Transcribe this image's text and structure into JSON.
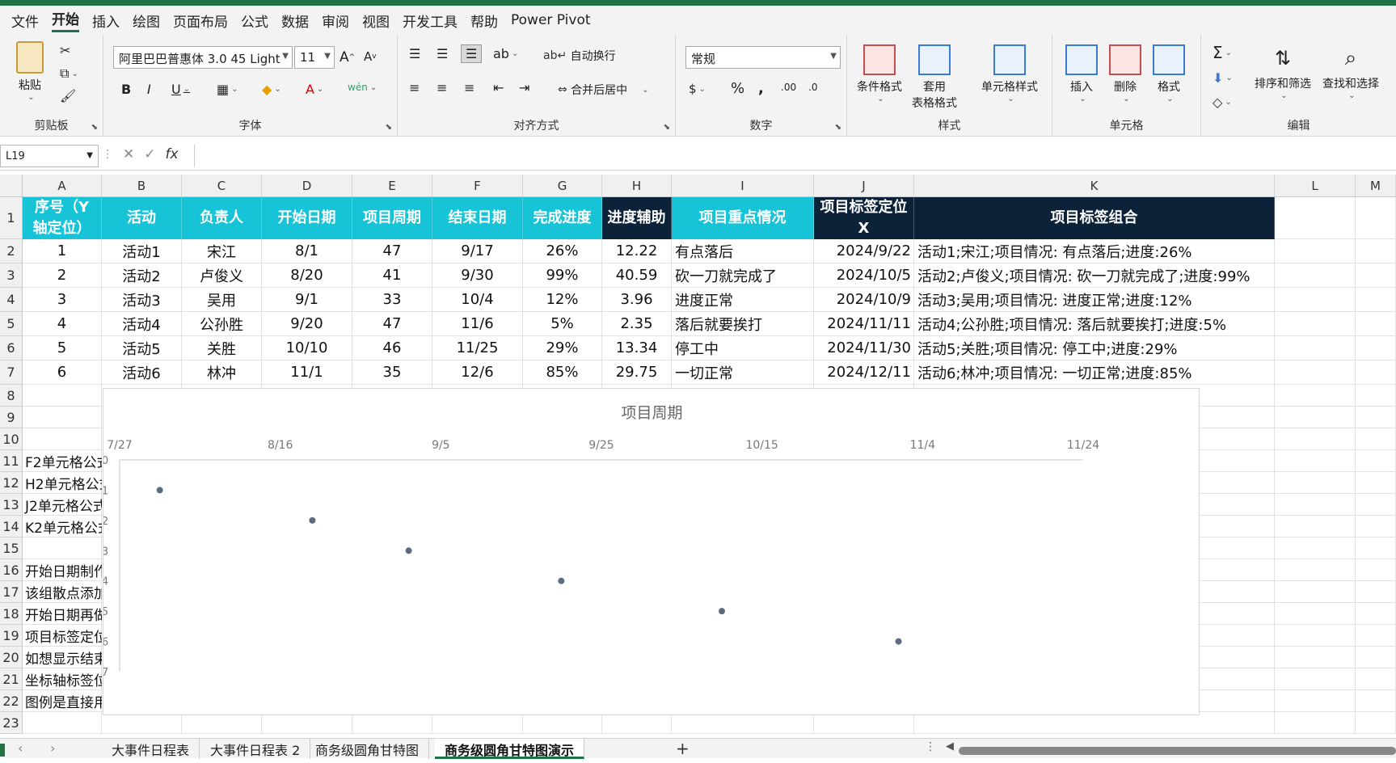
{
  "menu": [
    "文件",
    "开始",
    "插入",
    "绘图",
    "页面布局",
    "公式",
    "数据",
    "审阅",
    "视图",
    "开发工具",
    "帮助",
    "Power Pivot"
  ],
  "ribbon": {
    "clipboard": {
      "paste": "粘贴",
      "label": "剪贴板"
    },
    "font": {
      "name": "阿里巴巴普惠体 3.0 45 Light",
      "size": "11",
      "label": "字体"
    },
    "alignment": {
      "wrap": "自动换行",
      "merge": "合并后居中",
      "label": "对齐方式"
    },
    "number": {
      "format": "常规",
      "label": "数字"
    },
    "styles": {
      "conditional": "条件格式",
      "table_line1": "套用",
      "table_line2": "表格格式",
      "cell_styles": "单元格样式",
      "label": "样式"
    },
    "cells": {
      "insert": "插入",
      "delete": "删除",
      "format": "格式",
      "label": "单元格"
    },
    "editing": {
      "sort": "排序和筛选",
      "find": "查找和选择",
      "label": "编辑"
    }
  },
  "namebox": "L19",
  "columns": [
    "A",
    "B",
    "C",
    "D",
    "E",
    "F",
    "G",
    "H",
    "I",
    "J",
    "K",
    "L",
    "M"
  ],
  "rows": [
    "1",
    "2",
    "3",
    "4",
    "5",
    "6",
    "7",
    "8",
    "9",
    "10",
    "11",
    "12",
    "13",
    "14",
    "15",
    "16",
    "17",
    "18",
    "19",
    "20",
    "21",
    "22",
    "23"
  ],
  "headers": {
    "A": "序号（Y轴定位）",
    "B": "活动",
    "C": "负责人",
    "D": "开始日期",
    "E": "项目周期",
    "F": "结束日期",
    "G": "完成进度",
    "H": "进度辅助",
    "I": "项目重点情况",
    "J": "项目标签定位X",
    "K": "项目标签组合"
  },
  "table": [
    {
      "a": "1",
      "b": "活动1",
      "c": "宋江",
      "d": "8/1",
      "e": "47",
      "f": "9/17",
      "g": "26%",
      "h": "12.22",
      "i": "有点落后",
      "j": "2024/9/22",
      "k": "活动1;宋江;项目情况: 有点落后;进度:26%"
    },
    {
      "a": "2",
      "b": "活动2",
      "c": "卢俊义",
      "d": "8/20",
      "e": "41",
      "f": "9/30",
      "g": "99%",
      "h": "40.59",
      "i": "砍一刀就完成了",
      "j": "2024/10/5",
      "k": "活动2;卢俊义;项目情况: 砍一刀就完成了;进度:99%"
    },
    {
      "a": "3",
      "b": "活动3",
      "c": "吴用",
      "d": "9/1",
      "e": "33",
      "f": "10/4",
      "g": "12%",
      "h": "3.96",
      "i": "进度正常",
      "j": "2024/10/9",
      "k": "活动3;吴用;项目情况: 进度正常;进度:12%"
    },
    {
      "a": "4",
      "b": "活动4",
      "c": "公孙胜",
      "d": "9/20",
      "e": "47",
      "f": "11/6",
      "g": "5%",
      "h": "2.35",
      "i": "落后就要挨打",
      "j": "2024/11/11",
      "k": "活动4;公孙胜;项目情况: 落后就要挨打;进度:5%"
    },
    {
      "a": "5",
      "b": "活动5",
      "c": "关胜",
      "d": "10/10",
      "e": "46",
      "f": "11/25",
      "g": "29%",
      "h": "13.34",
      "i": "停工中",
      "j": "2024/11/30",
      "k": "活动5;关胜;项目情况: 停工中;进度:29%"
    },
    {
      "a": "6",
      "b": "活动6",
      "c": "林冲",
      "d": "11/1",
      "e": "35",
      "f": "12/6",
      "g": "85%",
      "h": "29.75",
      "i": "一切正常",
      "j": "2024/12/11",
      "k": "活动6;林冲;项目情况: 一切正常;进度:85%"
    }
  ],
  "notes": [
    {
      "row": "11",
      "text": "F2单元格公式"
    },
    {
      "row": "12",
      "text": "H2单元格公式"
    },
    {
      "row": "13",
      "text": "J2单元格公式"
    },
    {
      "row": "14",
      "text": "K2单元格公式"
    },
    {
      "row": "16",
      "text": "开始日期制作"
    },
    {
      "row": "17",
      "text": "该组散点添加"
    },
    {
      "row": "18",
      "text": "开始日期再做"
    },
    {
      "row": "19",
      "text": "项目标签定位"
    },
    {
      "row": "20",
      "text": "如想显示结束"
    },
    {
      "row": "21",
      "text": "坐标轴标签位"
    },
    {
      "row": "22",
      "text": "图例是直接用"
    }
  ],
  "chart_data": {
    "type": "scatter",
    "title": "项目周期",
    "x_ticks": [
      "7/27",
      "8/16",
      "9/5",
      "9/25",
      "10/15",
      "11/4",
      "11/24"
    ],
    "y_ticks": [
      "0",
      "1",
      "2",
      "3",
      "4",
      "5",
      "6",
      "7"
    ],
    "ylim": [
      0,
      7
    ],
    "y_reversed": true,
    "x_axis_position": "top",
    "points": [
      {
        "x": "8/1",
        "y": 1
      },
      {
        "x": "8/20",
        "y": 2
      },
      {
        "x": "9/1",
        "y": 3
      },
      {
        "x": "9/20",
        "y": 4
      },
      {
        "x": "10/10",
        "y": 5
      },
      {
        "x": "11/1",
        "y": 6
      }
    ],
    "point_color": "#5c6b80"
  },
  "tabs": [
    "大事件日程表",
    "大事件日程表 2",
    "商务级圆角甘特图",
    "商务级圆角甘特图演示"
  ],
  "active_tab": "商务级圆角甘特图演示",
  "colors": {
    "teal": "#17c3d6",
    "navy": "#0c2238",
    "excel_green": "#217346"
  }
}
